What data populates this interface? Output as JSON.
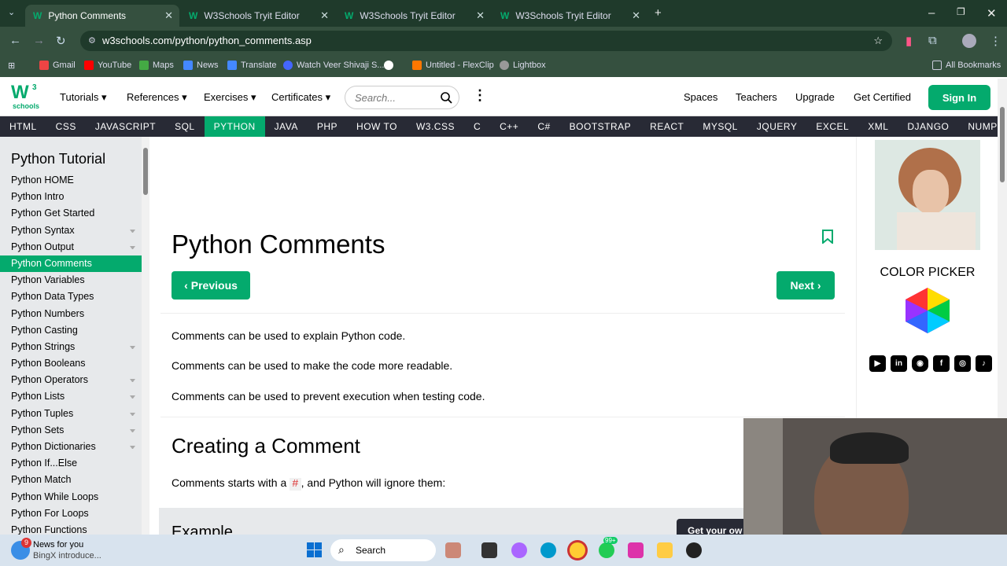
{
  "browser": {
    "tabs": [
      {
        "title": "Python Comments",
        "active": true
      },
      {
        "title": "W3Schools Tryit Editor",
        "active": false
      },
      {
        "title": "W3Schools Tryit Editor",
        "active": false
      },
      {
        "title": "W3Schools Tryit Editor",
        "active": false
      }
    ],
    "url": "w3schools.com/python/python_comments.asp",
    "bookmarks": [
      "Gmail",
      "YouTube",
      "Maps",
      "News",
      "Translate",
      "Watch Veer Shivaji S...",
      "Untitled - FlexClip",
      "Lightbox"
    ],
    "all_bookmarks": "All Bookmarks"
  },
  "site": {
    "logo_text": "schools",
    "logo_sup": "3",
    "menu": [
      "Tutorials",
      "References",
      "Exercises",
      "Certificates"
    ],
    "search_placeholder": "Search...",
    "right_links": [
      "Spaces",
      "Teachers",
      "Upgrade",
      "Get Certified"
    ],
    "sign_in": "Sign In",
    "topnav": [
      "HTML",
      "CSS",
      "JAVASCRIPT",
      "SQL",
      "PYTHON",
      "JAVA",
      "PHP",
      "HOW TO",
      "W3.CSS",
      "C",
      "C++",
      "C#",
      "BOOTSTRAP",
      "REACT",
      "MYSQL",
      "JQUERY",
      "EXCEL",
      "XML",
      "DJANGO",
      "NUMPY"
    ],
    "topnav_active": "PYTHON"
  },
  "sidebar": {
    "title": "Python Tutorial",
    "items": [
      "Python HOME",
      "Python Intro",
      "Python Get Started",
      "Python Syntax",
      "Python Output",
      "Python Comments",
      "Python Variables",
      "Python Data Types",
      "Python Numbers",
      "Python Casting",
      "Python Strings",
      "Python Booleans",
      "Python Operators",
      "Python Lists",
      "Python Tuples",
      "Python Sets",
      "Python Dictionaries",
      "Python If...Else",
      "Python Match",
      "Python While Loops",
      "Python For Loops",
      "Python Functions"
    ],
    "active": "Python Comments"
  },
  "main": {
    "title": "Python Comments",
    "prev": "Previous",
    "next": "Next",
    "paras": [
      "Comments can be used to explain Python code.",
      "Comments can be used to make the code more readable.",
      "Comments can be used to prevent execution when testing code."
    ],
    "h2": "Creating a Comment",
    "intro_before": "Comments starts with a ",
    "intro_code": "#",
    "intro_after": ", and Python will ignore them:",
    "example_label": "Example",
    "get_own": "Get your ow"
  },
  "right": {
    "color_picker": "COLOR PICKER"
  },
  "taskbar": {
    "news_title": "News for you",
    "news_sub": "BingX introduce...",
    "news_badge": "9",
    "search": "Search",
    "badge_99": "99+"
  }
}
